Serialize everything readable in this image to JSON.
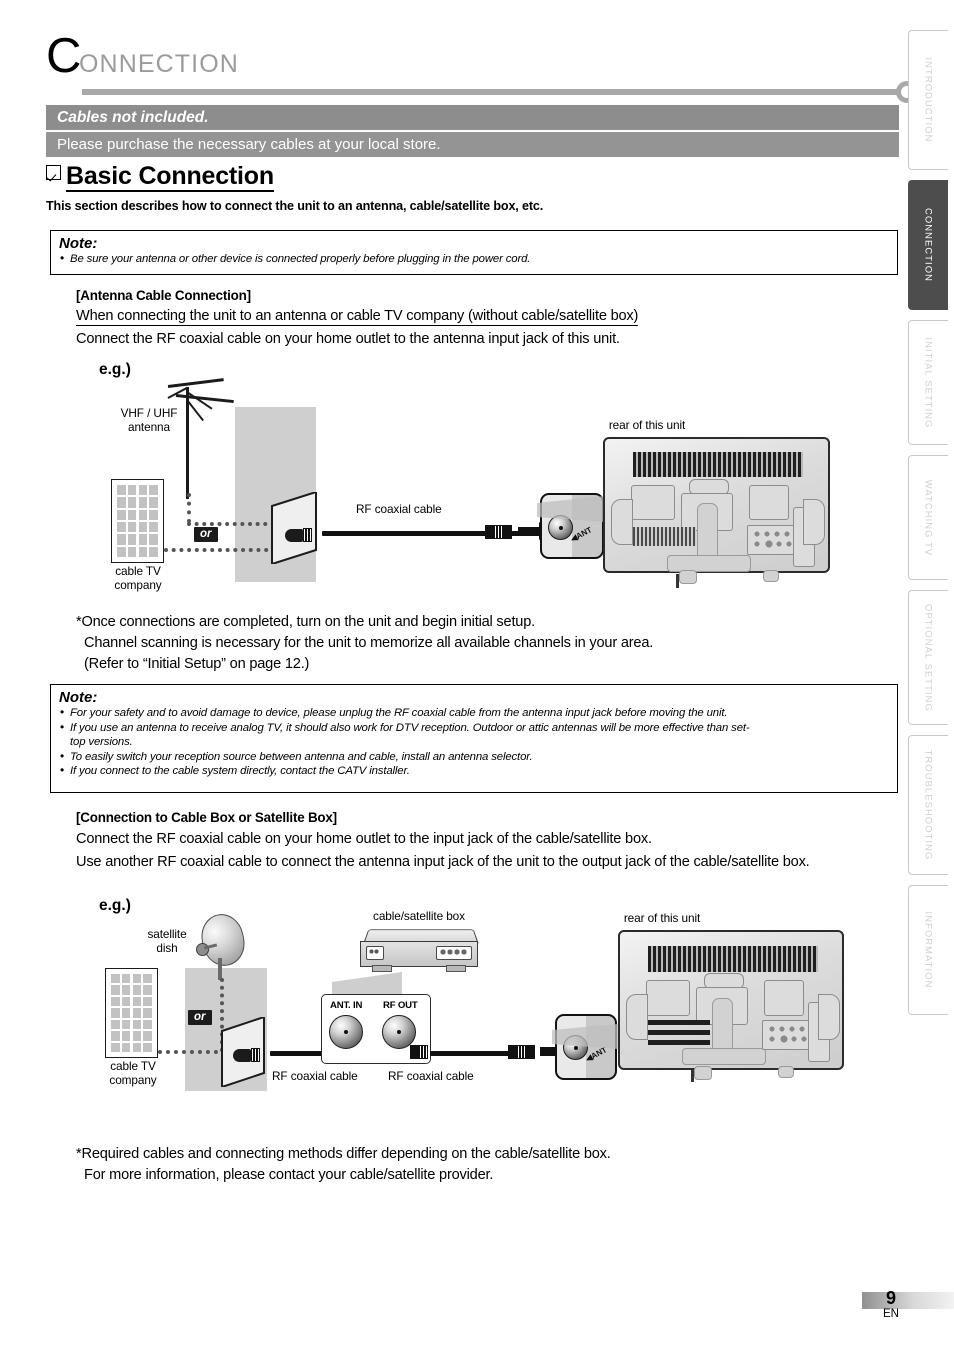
{
  "page": {
    "chapter_initial": "C",
    "chapter_rest": "ONNECTION",
    "page_number": "9",
    "language_code": "EN"
  },
  "banner": {
    "headline": "Cables not included.",
    "subline": "Please purchase the necessary cables at your local store."
  },
  "basic_connection": {
    "heading": "Basic Connection",
    "subheading": "This section describes how to connect the unit to an antenna, cable/satellite box, etc."
  },
  "note_top": {
    "title": "Note:",
    "items": [
      "Be sure your antenna or other device is connected properly before plugging in the power cord."
    ]
  },
  "antenna_section": {
    "heading": "[Antenna Cable Connection]",
    "line1": "When connecting the unit to an antenna or cable TV company (without cable/satellite box)",
    "line2": "Connect the RF coaxial cable on your home outlet to the antenna input jack of this unit.",
    "eg": "e.g.)"
  },
  "diagram1": {
    "antenna_label": "VHF / UHF\nantenna",
    "antenna_label_l1": "VHF / UHF",
    "antenna_label_l2": "antenna",
    "or_label": "or",
    "cable_tv_l1": "cable TV",
    "cable_tv_l2": "company",
    "rf_cable_label": "RF coaxial cable",
    "rear_label": "rear of this unit",
    "ant_jack_label": "ANT"
  },
  "star_note1": {
    "line1": "*Once connections are completed, turn on the unit and begin initial setup.",
    "line2": "Channel scanning is necessary for the unit to memorize all available channels in your area.",
    "line3": "(Refer to “Initial Setup” on page 12.)"
  },
  "note_bottom": {
    "title": "Note:",
    "items": [
      "For your safety and to avoid damage to device, please unplug the RF coaxial cable from the antenna input jack before moving the unit.",
      "If you use an antenna to receive analog TV, it should also work for DTV reception. Outdoor or attic antennas will be more effective than set-",
      "To easily switch your reception source between antenna and cable, install an antenna selector.",
      "If you connect to the cable system directly, contact the CATV installer."
    ],
    "item2_continuation": "top versions."
  },
  "cablebox_section": {
    "heading": "[Connection to Cable Box or Satellite Box]",
    "line1": "Connect the RF coaxial cable on your home outlet to the input jack of the cable/satellite box.",
    "line2": "Use another RF coaxial cable to connect the antenna input jack of the unit to the output jack of the cable/satellite box.",
    "eg": "e.g.)"
  },
  "diagram2": {
    "dish_label_l1": "satellite",
    "dish_label_l2": "dish",
    "or_label": "or",
    "cable_tv_l1": "cable TV",
    "cable_tv_l2": "company",
    "box_label": "cable/satellite box",
    "ant_in_label": "ANT. IN",
    "rf_out_label": "RF OUT",
    "rf_cable_label_1": "RF coaxial cable",
    "rf_cable_label_2": "RF coaxial cable",
    "rear_label": "rear of this unit",
    "ant_jack_label": "ANT"
  },
  "star_note2": {
    "line1": "*Required cables and connecting methods differ depending on the cable/satellite box.",
    "line2": "For more information, please contact your cable/satellite provider."
  },
  "side_tabs": [
    {
      "label": "INTRODUCTION",
      "active": false
    },
    {
      "label": "CONNECTION",
      "active": true
    },
    {
      "label": "INITIAL  SETTING",
      "active": false
    },
    {
      "label": "WATCHING  TV",
      "active": false
    },
    {
      "label": "OPTIONAL  SETTING",
      "active": false
    },
    {
      "label": "TROUBLESHOOTING",
      "active": false
    },
    {
      "label": "INFORMATION",
      "active": false
    }
  ],
  "colors": {
    "banner_dark": "#8d8d8d",
    "banner_light": "#949494",
    "rule": "#a8a8a8",
    "active_tab": "#4d4d4d",
    "tab_text": "#cfcfcf"
  }
}
